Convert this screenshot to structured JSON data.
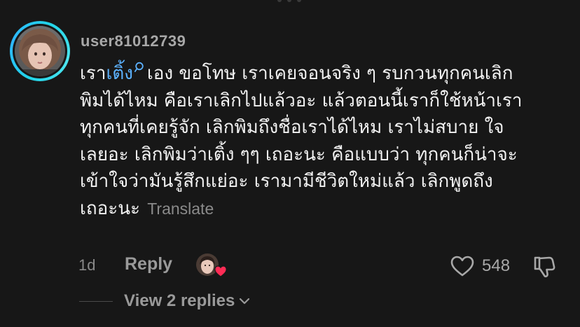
{
  "comment": {
    "username": "user81012739",
    "mention": "เติ้ง",
    "lines": [
      {
        "before_mention": "เรา",
        "after_mention": "เอง ขอโทษ เราเคยจอนจริง ๆ รบกวนทุกคนเลิก"
      },
      "พิมได้ไหม คือเราเลิกไปแล้วอะ แล้วตอนนี้เราก็ใช้หน้าเรา",
      "ทุกคนที่เคยรู้จัก เลิกพิมถึงชื่อเราได้ไหม เราไม่สบาย ใจ",
      "เลยอะ เลิกพิมว่าเติ้ง ๆๆ เถอะนะ คือแบบว่า ทุกคนก็น่าจะ",
      "เข้าใจว่ามันรู้สึกแย่อะ เรามามีชีวิตใหม่แล้ว เลิกพูดถึง",
      "เถอะนะ"
    ],
    "translate_label": "Translate",
    "timestamp": "1d",
    "reply_label": "Reply",
    "like_count": "548",
    "view_replies_label": "View 2 replies"
  },
  "icons": {
    "mention_search": "search-icon",
    "like": "heart-outline-icon",
    "dislike": "thumbs-down-icon",
    "creator_like_badge": "heart-filled-icon",
    "chevron": "chevron-down-icon"
  },
  "colors": {
    "background": "#171717",
    "mention": "#5cb2ff",
    "avatar_ring": "#21d4e8",
    "heart_badge": "#fe2c55",
    "muted_text": "#9a9a9a"
  }
}
